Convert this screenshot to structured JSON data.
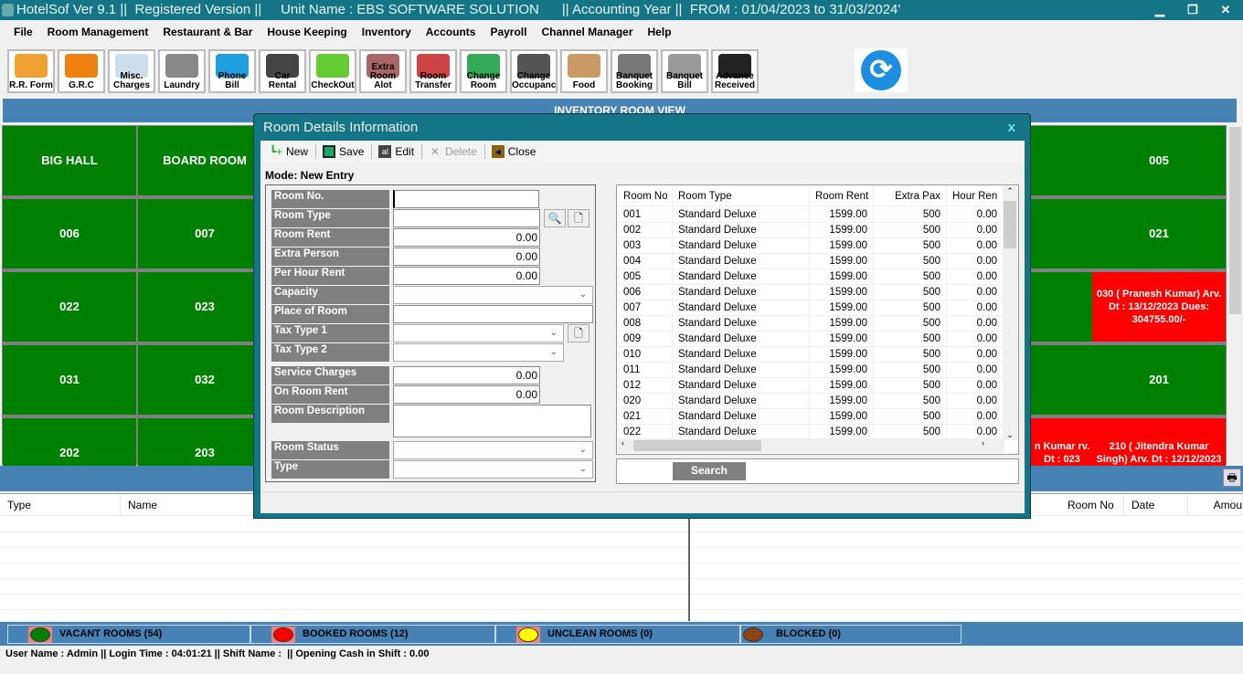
{
  "title": "HotelSof Ver 9.1 ||  Registered Version ||     Unit Name : EBS SOFTWARE SOLUTION      || Accounting Year ||  FROM : 01/04/2023 to 31/03/2024'",
  "window_buttons": {
    "minimize": "▁",
    "restore": "❐",
    "close": "✕"
  },
  "menu": [
    "File",
    "Room Management",
    "Restaurant & Bar",
    "House Keeping",
    "Inventory",
    "Accounts",
    "Payroll",
    "Channel Manager",
    "Help"
  ],
  "toolbar": [
    {
      "label": "R.R. Form",
      "color": "#f0a030"
    },
    {
      "label": "G.R.C",
      "color": "#f08010"
    },
    {
      "label": "Misc. Charges",
      "color": "#cde"
    },
    {
      "label": "Laundry",
      "color": "#888"
    },
    {
      "label": "Phone Bill",
      "color": "#1ea0e0"
    },
    {
      "label": "Car Rental",
      "color": "#444"
    },
    {
      "label": "CheckOut",
      "color": "#6c3"
    },
    {
      "label": "Extra Room Alot",
      "color": "#a66"
    },
    {
      "label": "Room Transfer",
      "color": "#c44"
    },
    {
      "label": "Change Room",
      "color": "#3a5"
    },
    {
      "label": "Change Occupancy",
      "color": "#555"
    },
    {
      "label": "Food",
      "color": "#c96"
    },
    {
      "label": "Banquet Booking",
      "color": "#777"
    },
    {
      "label": "Banquet Bill",
      "color": "#999"
    },
    {
      "label": "Advance Received",
      "color": "#222"
    }
  ],
  "inventory_header": "INVENTORY ROOM VIEW",
  "rooms": [
    {
      "text": "BIG HALL",
      "status": "vacant"
    },
    {
      "text": "BOARD ROOM",
      "status": "vacant"
    },
    {
      "text": "",
      "status": "vacant"
    },
    {
      "text": "005",
      "status": "vacant"
    },
    {
      "text": "006",
      "status": "vacant"
    },
    {
      "text": "007",
      "status": "vacant"
    },
    {
      "text": "",
      "status": "vacant"
    },
    {
      "text": "021",
      "status": "vacant"
    },
    {
      "text": "022",
      "status": "vacant"
    },
    {
      "text": "023",
      "status": "vacant"
    },
    {
      "text": "",
      "status": "vacant"
    },
    {
      "text": "030 ( Pranesh Kumar) Arv. Dt : 13/12/2023 Dues: 304755.00/-",
      "status": "booked"
    },
    {
      "text": "031",
      "status": "vacant"
    },
    {
      "text": "032",
      "status": "vacant"
    },
    {
      "text": "",
      "status": "vacant"
    },
    {
      "text": "201",
      "status": "vacant"
    },
    {
      "text": "202",
      "status": "vacant"
    },
    {
      "text": "203",
      "status": "vacant"
    },
    {
      "text": "n Kumar rv. Dt : 023",
      "status": "booked"
    },
    {
      "text": "210 ( Jitendra Kumar Singh) Arv. Dt : 12/12/2023",
      "status": "booked"
    }
  ],
  "colors": {
    "vacant": "#008000",
    "booked": "#ff0000",
    "unclean": "#ffff00",
    "blocked": "#8b4513",
    "header": "#4682b4",
    "titlebar": "#137585"
  },
  "left_table": {
    "columns": [
      "Type",
      "Name"
    ]
  },
  "right_table": {
    "columns": [
      "Room No",
      "Date",
      "Amou"
    ]
  },
  "legend": [
    {
      "label": "VACANT ROOMS (54)",
      "color": "#008000"
    },
    {
      "label": "BOOKED ROOMS (12)",
      "color": "#ff0000"
    },
    {
      "label": "UNCLEAN ROOMS (0)",
      "color": "#ffff00"
    },
    {
      "label": "BLOCKED (0)",
      "color": "#8b4513"
    }
  ],
  "status_line": "User Name : Admin || Login Time : 04:01:21 || Shift Name :  || Opening Cash in Shift : 0.00",
  "dialog": {
    "title": "Room Details Information",
    "close": "x",
    "tools": {
      "new": "New",
      "save": "Save",
      "edit": "Edit",
      "delete": "Delete",
      "close": "Close"
    },
    "mode": "Mode: New Entry",
    "fields": {
      "room_no": {
        "label": "Room No.",
        "value": ""
      },
      "room_type": {
        "label": "Room Type",
        "value": ""
      },
      "room_rent": {
        "label": "Room Rent",
        "value": "0.00"
      },
      "extra_person": {
        "label": "Extra Person",
        "value": "0.00"
      },
      "per_hour_rent": {
        "label": "Per Hour Rent",
        "value": "0.00"
      },
      "capacity": {
        "label": "Capacity",
        "value": ""
      },
      "place_of_room": {
        "label": "Place of Room",
        "value": ""
      },
      "tax_type_1": {
        "label": "Tax Type 1",
        "value": ""
      },
      "tax_type_2": {
        "label": "Tax Type 2",
        "value": ""
      },
      "service_charges": {
        "label": "Service Charges",
        "value": "0.00"
      },
      "on_room_rent": {
        "label": "On Room Rent",
        "value": "0.00"
      },
      "room_description": {
        "label": "Room Description",
        "value": ""
      },
      "room_status": {
        "label": "Room Status",
        "value": ""
      },
      "type": {
        "label": "Type",
        "value": ""
      }
    },
    "table": {
      "columns": [
        "Room No",
        "Room Type",
        "Room Rent",
        "Extra Pax",
        "Hour Ren"
      ],
      "rows": [
        [
          "001",
          "Standard Deluxe",
          "1599.00",
          "500",
          "0.00"
        ],
        [
          "002",
          "Standard Deluxe",
          "1599.00",
          "500",
          "0.00"
        ],
        [
          "003",
          "Standard Deluxe",
          "1599.00",
          "500",
          "0.00"
        ],
        [
          "004",
          "Standard Deluxe",
          "1599.00",
          "500",
          "0.00"
        ],
        [
          "005",
          "Standard Deluxe",
          "1599.00",
          "500",
          "0.00"
        ],
        [
          "006",
          "Standard Deluxe",
          "1599.00",
          "500",
          "0.00"
        ],
        [
          "007",
          "Standard Deluxe",
          "1599.00",
          "500",
          "0.00"
        ],
        [
          "008",
          "Standard Deluxe",
          "1599.00",
          "500",
          "0.00"
        ],
        [
          "009",
          "Standard Deluxe",
          "1599.00",
          "500",
          "0.00"
        ],
        [
          "010",
          "Standard Deluxe",
          "1599.00",
          "500",
          "0.00"
        ],
        [
          "011",
          "Standard Deluxe",
          "1599.00",
          "500",
          "0.00"
        ],
        [
          "012",
          "Standard Deluxe",
          "1599.00",
          "500",
          "0.00"
        ],
        [
          "020",
          "Standard Deluxe",
          "1599.00",
          "500",
          "0.00"
        ],
        [
          "021",
          "Standard Deluxe",
          "1599.00",
          "500",
          "0.00"
        ],
        [
          "022",
          "Standard Deluxe",
          "1599.00",
          "500",
          "0.00"
        ]
      ]
    },
    "search": "Search"
  }
}
